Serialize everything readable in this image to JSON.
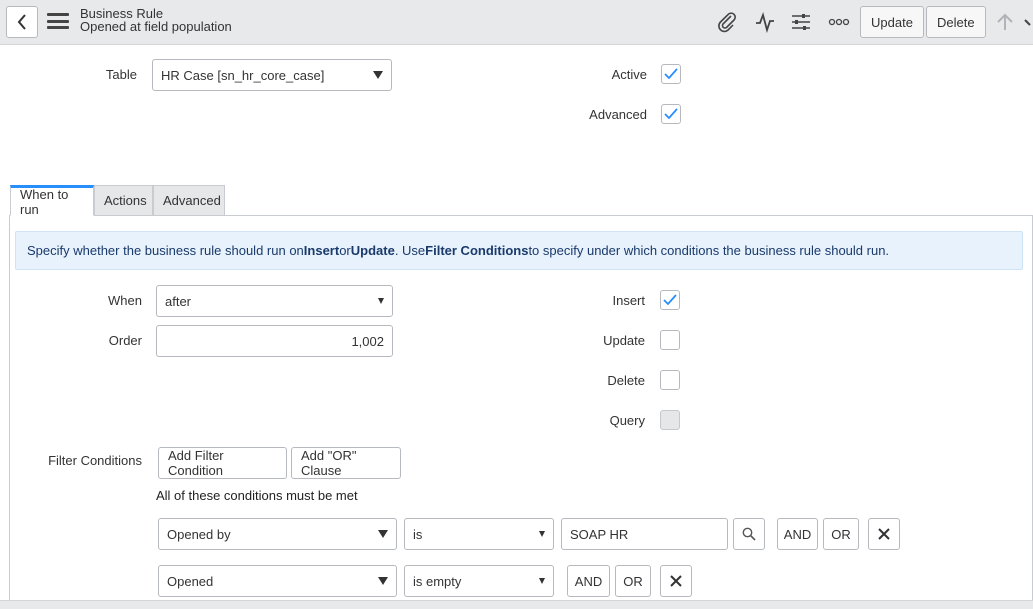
{
  "header": {
    "title": "Business Rule",
    "subtitle": "Opened at field population",
    "update_label": "Update",
    "delete_label": "Delete"
  },
  "form": {
    "table_label": "Table",
    "table_value": "HR Case [sn_hr_core_case]",
    "active_label": "Active",
    "active_checked": true,
    "advanced_label": "Advanced",
    "advanced_checked": true
  },
  "tabs": [
    {
      "label": "When to run",
      "active": true
    },
    {
      "label": "Actions",
      "active": false
    },
    {
      "label": "Advanced",
      "active": false
    }
  ],
  "info": {
    "part1": "Specify whether the business rule should run on ",
    "insert": "Insert",
    "part2": " or ",
    "update": "Update",
    "part3": ". Use ",
    "filter": "Filter Conditions",
    "part4": " to specify under which conditions the business rule should run."
  },
  "when_to_run": {
    "when_label": "When",
    "when_value": "after",
    "order_label": "Order",
    "order_value": "1,002",
    "insert_label": "Insert",
    "insert_checked": true,
    "update_label": "Update",
    "update_checked": false,
    "delete_label": "Delete",
    "delete_checked": false,
    "query_label": "Query",
    "query_checked": false
  },
  "filter": {
    "label": "Filter Conditions",
    "add_filter_label": "Add Filter Condition",
    "add_or_label": "Add \"OR\" Clause",
    "all_met_text": "All of these conditions must be met",
    "and_label": "AND",
    "or_label": "OR",
    "conditions": [
      {
        "field": "Opened by",
        "operator": "is",
        "value": "SOAP HR"
      },
      {
        "field": "Opened",
        "operator": "is empty",
        "value": ""
      }
    ]
  },
  "colors": {
    "accent": "#278efc",
    "info_bg": "#e7f2fc",
    "header_bg": "#e8e9ea"
  }
}
